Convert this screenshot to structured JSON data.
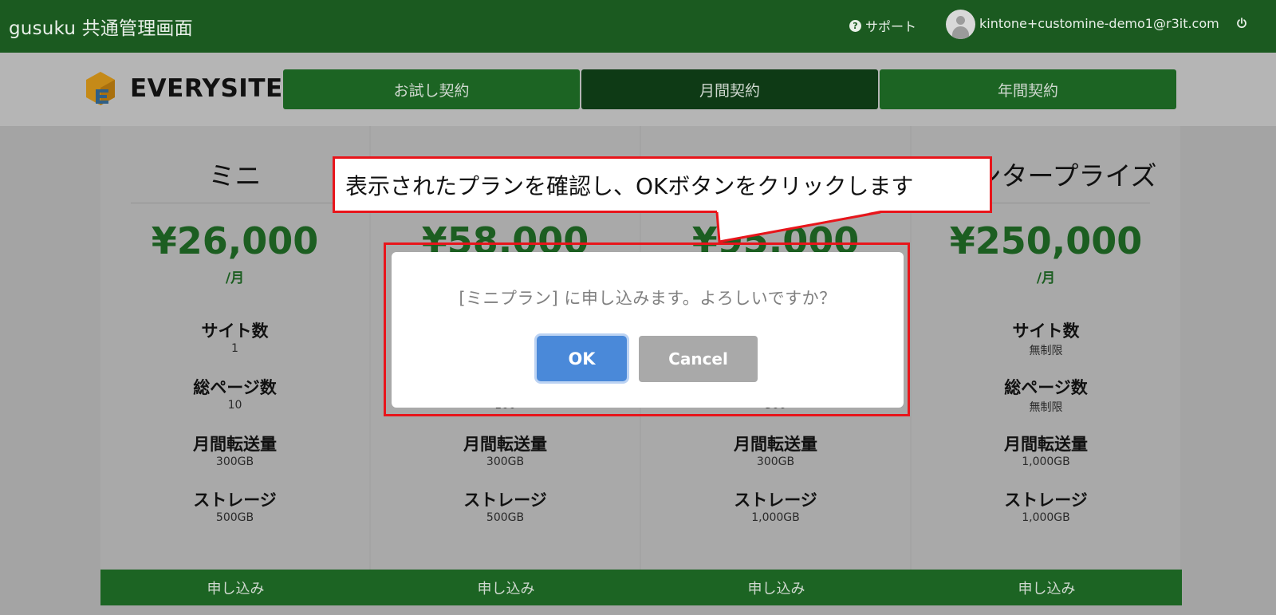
{
  "header": {
    "app_title": "gusuku 共通管理画面",
    "support_label": "サポート",
    "user_email": "kintone+customine-demo1@r3it.com"
  },
  "brand": {
    "logo_text": "EVERYSITE"
  },
  "tabs": [
    {
      "label": "お試し契約",
      "active": false
    },
    {
      "label": "月間契約",
      "active": true
    },
    {
      "label": "年間契約",
      "active": false
    }
  ],
  "plans": [
    {
      "name": "ミニ",
      "price": "¥26,000",
      "per": "/月",
      "features": [
        {
          "label": "サイト数",
          "value": "1"
        },
        {
          "label": "総ページ数",
          "value": "10"
        },
        {
          "label": "月間転送量",
          "value": "300GB"
        },
        {
          "label": "ストレージ",
          "value": "500GB"
        }
      ],
      "apply_label": "申し込み"
    },
    {
      "name": "",
      "price": "¥58,000",
      "per": "",
      "features": [
        {
          "label": "",
          "value": ""
        },
        {
          "label": "",
          "value": "100"
        },
        {
          "label": "月間転送量",
          "value": "300GB"
        },
        {
          "label": "ストレージ",
          "value": "500GB"
        }
      ],
      "apply_label": "申し込み"
    },
    {
      "name": "",
      "price": "¥95,000",
      "per": "",
      "features": [
        {
          "label": "",
          "value": ""
        },
        {
          "label": "",
          "value": "500"
        },
        {
          "label": "月間転送量",
          "value": "300GB"
        },
        {
          "label": "ストレージ",
          "value": "1,000GB"
        }
      ],
      "apply_label": "申し込み"
    },
    {
      "name": "ンタープライズ",
      "price": "¥250,000",
      "per": "/月",
      "features": [
        {
          "label": "サイト数",
          "value": "無制限"
        },
        {
          "label": "総ページ数",
          "value": "無制限"
        },
        {
          "label": "月間転送量",
          "value": "1,000GB"
        },
        {
          "label": "ストレージ",
          "value": "1,000GB"
        }
      ],
      "apply_label": "申し込み"
    }
  ],
  "dialog": {
    "message": "[ミニプラン] に申し込みます。よろしいですか？",
    "ok_label": "OK",
    "cancel_label": "Cancel"
  },
  "annotation": {
    "callout_text": "表示されたプランを確認し、OKボタンをクリックします",
    "color": "#e8151b"
  },
  "colors": {
    "header_green": "#1b5a20",
    "button_green": "#1c6423",
    "active_tab": "#0e3a15",
    "price_green": "#1c5e21",
    "ok_blue": "#4a89d9"
  }
}
